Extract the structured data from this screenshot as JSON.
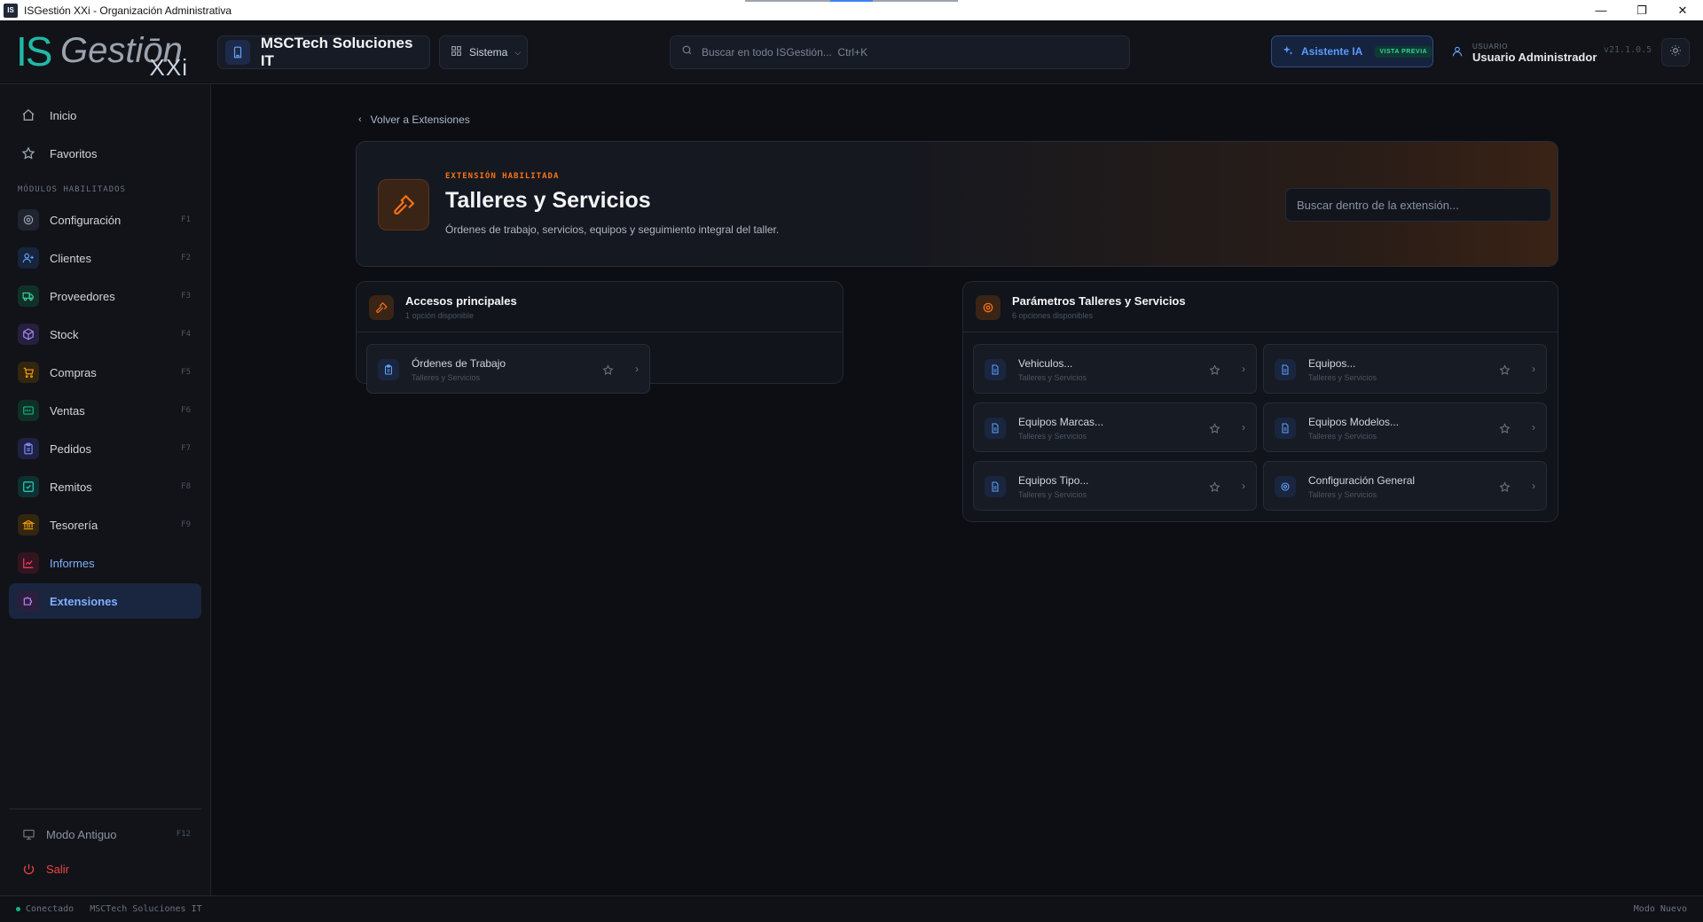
{
  "window": {
    "title": "ISGestión XXi - Organización Administrativa",
    "logo": "IS"
  },
  "brand": {
    "is": "IS",
    "gestion": "Gestiōn",
    "xxi": "XXi"
  },
  "header": {
    "company": "MSCTech Soluciones IT",
    "sistema_label": "Sistema",
    "search_placeholder": "Buscar en todo ISGestión...  Ctrl+K",
    "ai_label": "Asistente IA",
    "ai_badge": "VISTA PREVIA",
    "user_label": "USUARIO",
    "user_name": "Usuario Administrador",
    "version": "v21.1.0.5"
  },
  "sidebar": {
    "top_items": [
      {
        "label": "Inicio",
        "icon": "home-icon"
      },
      {
        "label": "Favoritos",
        "icon": "star-icon"
      }
    ],
    "section_label": "MÓDULOS HABILITADOS",
    "modules": [
      {
        "label": "Configuración",
        "key": "F1",
        "icon": "gear-icon",
        "color": "#9ca3af"
      },
      {
        "label": "Clientes",
        "key": "F2",
        "icon": "users-icon",
        "color": "#60a5fa"
      },
      {
        "label": "Proveedores",
        "key": "F3",
        "icon": "truck-icon",
        "color": "#34d399"
      },
      {
        "label": "Stock",
        "key": "F4",
        "icon": "box-icon",
        "color": "#a78bfa"
      },
      {
        "label": "Compras",
        "key": "F5",
        "icon": "cart-icon",
        "color": "#f59e0b"
      },
      {
        "label": "Ventas",
        "key": "F6",
        "icon": "register-icon",
        "color": "#10b981"
      },
      {
        "label": "Pedidos",
        "key": "F7",
        "icon": "clipboard-icon",
        "color": "#818cf8"
      },
      {
        "label": "Remitos",
        "key": "F8",
        "icon": "checkbox-icon",
        "color": "#2dd4bf"
      },
      {
        "label": "Tesorería",
        "key": "F9",
        "icon": "bank-icon",
        "color": "#f59e0b"
      },
      {
        "label": "Informes",
        "key": "",
        "icon": "chart-icon",
        "color": "#f43f5e"
      },
      {
        "label": "Extensiones",
        "key": "",
        "icon": "puzzle-icon",
        "color": "#c084fc"
      }
    ],
    "legacy_mode": {
      "label": "Modo Antiguo",
      "key": "F12"
    },
    "logout": "Salir"
  },
  "main": {
    "back_label": "Volver a Extensiones",
    "hero": {
      "tag": "EXTENSIÓN HABILITADA",
      "title": "Talleres y Servicios",
      "description": "Órdenes de trabajo, servicios, equipos y seguimiento integral del taller.",
      "search_placeholder": "Buscar dentro de la extensión..."
    },
    "access_panel": {
      "title": "Accesos principales",
      "subtitle": "1 opción disponible",
      "items": [
        {
          "name": "Órdenes de Trabajo",
          "sub": "Talleres y Servicios",
          "icon": "clipboard-icon"
        }
      ]
    },
    "params_panel": {
      "title": "Parámetros Talleres y Servicios",
      "subtitle": "6 opciones disponibles",
      "items": [
        {
          "name": "Vehiculos...",
          "sub": "Talleres y Servicios",
          "icon": "document-icon"
        },
        {
          "name": "Equipos...",
          "sub": "Talleres y Servicios",
          "icon": "document-icon"
        },
        {
          "name": "Equipos Marcas...",
          "sub": "Talleres y Servicios",
          "icon": "document-icon"
        },
        {
          "name": "Equipos Modelos...",
          "sub": "Talleres y Servicios",
          "icon": "document-icon"
        },
        {
          "name": "Equipos Tipo...",
          "sub": "Talleres y Servicios",
          "icon": "document-icon"
        },
        {
          "name": "Configuración General",
          "sub": "Talleres y Servicios",
          "icon": "gear-icon"
        }
      ]
    }
  },
  "statusbar": {
    "connection": "Conectado",
    "company": "MSCTech Soluciones IT",
    "mode": "Modo Nuevo"
  },
  "colors": {
    "accent": "#3b82f6",
    "brand_teal": "#22b8a6",
    "extension_orange": "#f97316",
    "danger": "#ef4444"
  }
}
